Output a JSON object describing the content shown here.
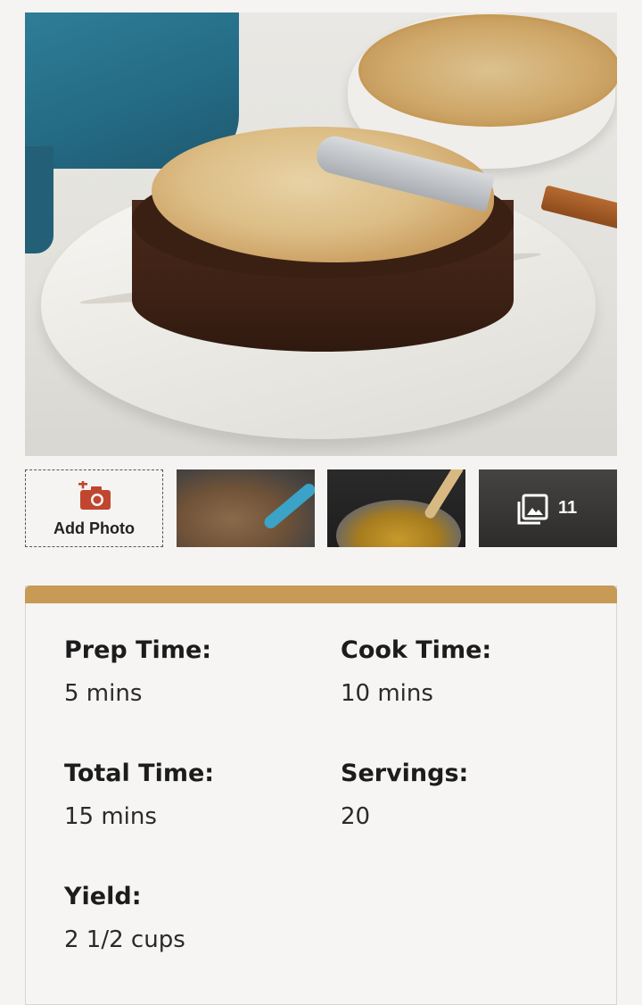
{
  "gallery": {
    "add_photo_label": "Add Photo",
    "photo_count": "11",
    "icons": {
      "add_photo": "camera-plus-icon",
      "gallery": "photo-library-icon"
    }
  },
  "details": {
    "prep_time": {
      "label": "Prep Time:",
      "value": "5 mins"
    },
    "cook_time": {
      "label": "Cook Time:",
      "value": "10 mins"
    },
    "total_time": {
      "label": "Total Time:",
      "value": "15 mins"
    },
    "servings": {
      "label": "Servings:",
      "value": "20"
    },
    "yield": {
      "label": "Yield:",
      "value": "2 1/2 cups"
    }
  },
  "colors": {
    "accent_bar": "#c79a55",
    "camera_icon": "#c0462f"
  }
}
